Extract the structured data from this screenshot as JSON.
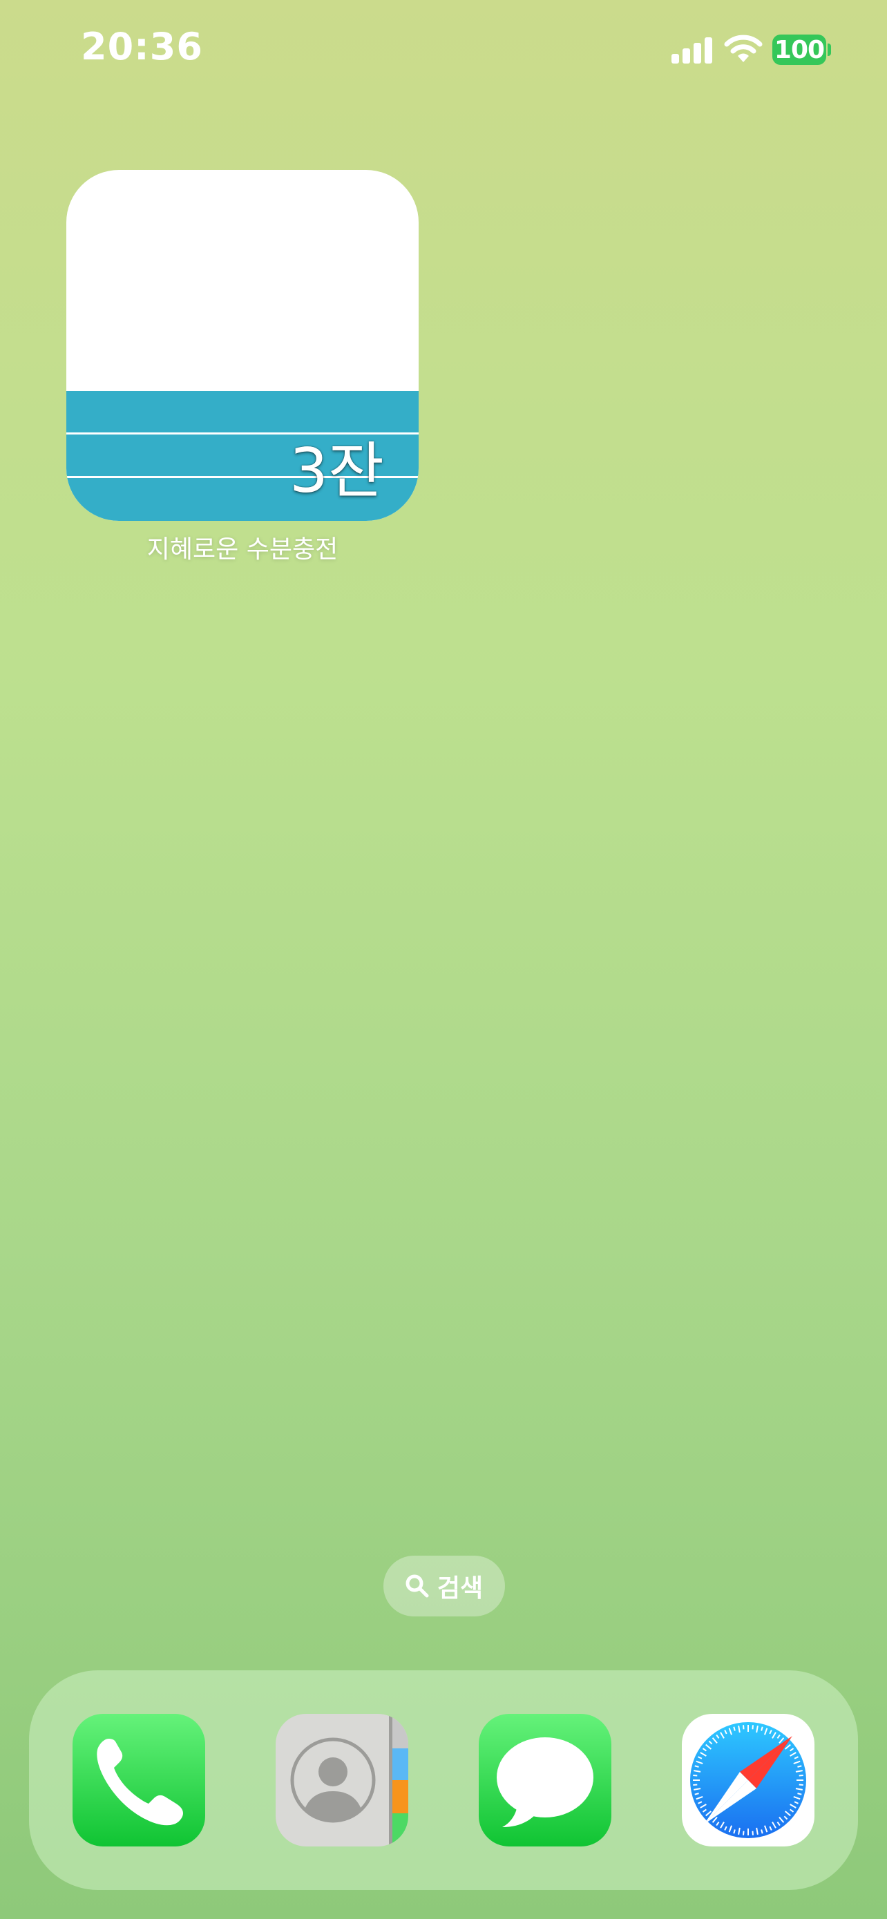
{
  "status_bar": {
    "time": "20:36",
    "battery_level": "100",
    "signal_bars": 4,
    "icons": [
      "signal-icon",
      "wifi-icon",
      "battery-icon"
    ]
  },
  "widget": {
    "count_text": "3잔",
    "app_label": "지혜로운 수분충전",
    "water_fill_fraction": 0.37,
    "colors": {
      "water": "#34aec8",
      "background": "#ffffff"
    }
  },
  "search": {
    "label": "검색",
    "icon": "search-icon"
  },
  "dock": {
    "apps": [
      {
        "icon": "phone-icon",
        "color": "#1fcf44"
      },
      {
        "icon": "contacts-icon",
        "color": "#d9d9d6"
      },
      {
        "icon": "messages-icon",
        "color": "#1fcf44"
      },
      {
        "icon": "safari-icon",
        "color": "#1e8cf5"
      }
    ]
  }
}
